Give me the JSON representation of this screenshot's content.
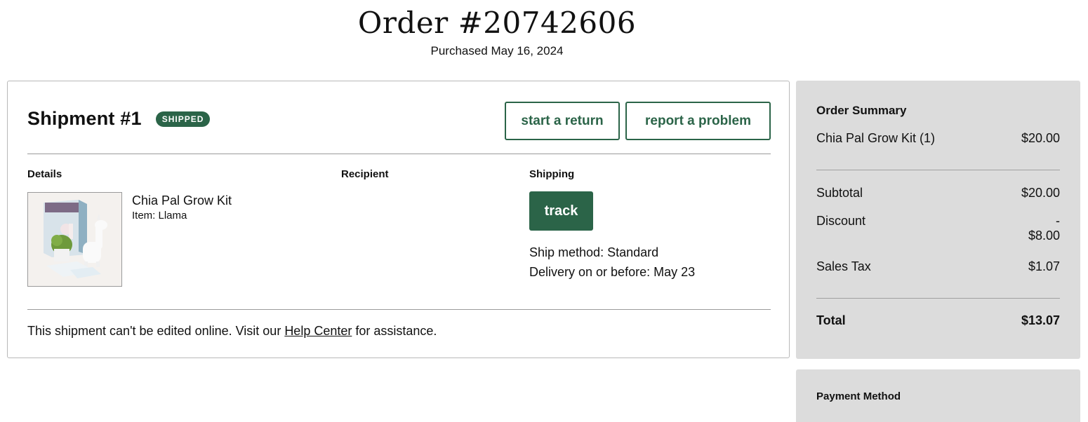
{
  "order": {
    "title": "Order #20742606",
    "purchased": "Purchased May 16, 2024"
  },
  "shipment": {
    "title": "Shipment #1",
    "status": "SHIPPED",
    "start_return_label": "start a return",
    "report_problem_label": "report a problem",
    "details_label": "Details",
    "recipient_label": "Recipient",
    "shipping_label": "Shipping",
    "product_name": "Chia Pal Grow Kit",
    "product_item": "Item: Llama",
    "track_label": "track",
    "ship_method": "Ship method: Standard",
    "delivery": "Delivery on or before: May 23",
    "note_before": "This shipment can't be edited online. Visit our ",
    "help_link": "Help Center",
    "note_after": " for assistance."
  },
  "summary": {
    "title": "Order Summary",
    "item_label": "Chia Pal Grow Kit (1)",
    "item_amount": "$20.00",
    "subtotal_label": "Subtotal",
    "subtotal_amount": "$20.00",
    "discount_label": "Discount",
    "discount_amount": "- $8.00",
    "tax_label": "Sales Tax",
    "tax_amount": "$1.07",
    "total_label": "Total",
    "total_amount": "$13.07"
  },
  "payment": {
    "title": "Payment Method"
  },
  "colors": {
    "accent": "#2b6448",
    "summary_bg": "#dcdcdc"
  }
}
